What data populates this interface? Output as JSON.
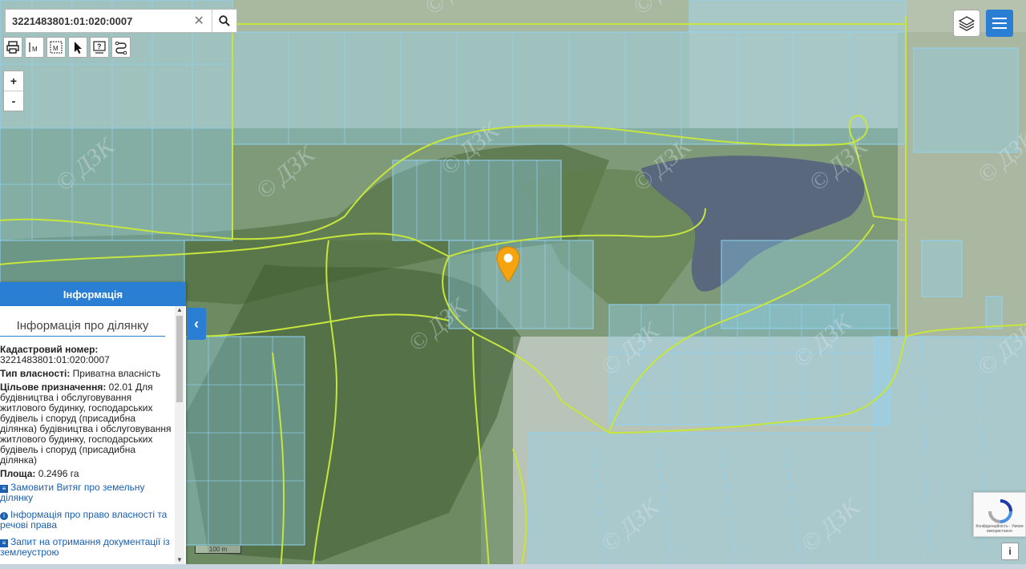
{
  "search": {
    "value": "3221483801:01:020:0007",
    "clear_icon": "close-icon",
    "search_icon": "search-icon"
  },
  "toolbar": {
    "tools": [
      "print-icon",
      "measure-line-icon",
      "measure-area-icon",
      "pointer-icon",
      "identify-icon",
      "route-icon"
    ]
  },
  "zoom": {
    "in": "+",
    "out": "-"
  },
  "panel": {
    "header": "Інформація",
    "title": "Інформація про ділянку",
    "cadastral_label": "Кадастровий номер:",
    "cadastral_value": "3221483801:01:020:0007",
    "ownership_label": "Тип власності:",
    "ownership_value": " Приватна власність",
    "purpose_label": "Цільове призначення:",
    "purpose_value": " 02.01 Для будівництва і обслуговування житлового будинку, господарських будівель і споруд (присадибна ділянка) будівництва і обслуговування житлового будинку, господарських будівель і споруд (присадибна ділянка)",
    "area_label": "Площа:",
    "area_value": " 0.2496 га",
    "links": [
      "Замовити Витяг про земельну ділянку",
      "Інформація про право власності та речові права",
      "Запит на отримання документації із землеустрою"
    ]
  },
  "scale": "100 m",
  "recaptcha_text": "Конфіденційність - Умови використання",
  "watermark": "© ДЗК",
  "colors": {
    "accent": "#2a7fd4",
    "parcel": "#8fd3f5",
    "boundary": "#c6e63c",
    "marker": "#f5a30f",
    "water": "#5a6b80"
  }
}
